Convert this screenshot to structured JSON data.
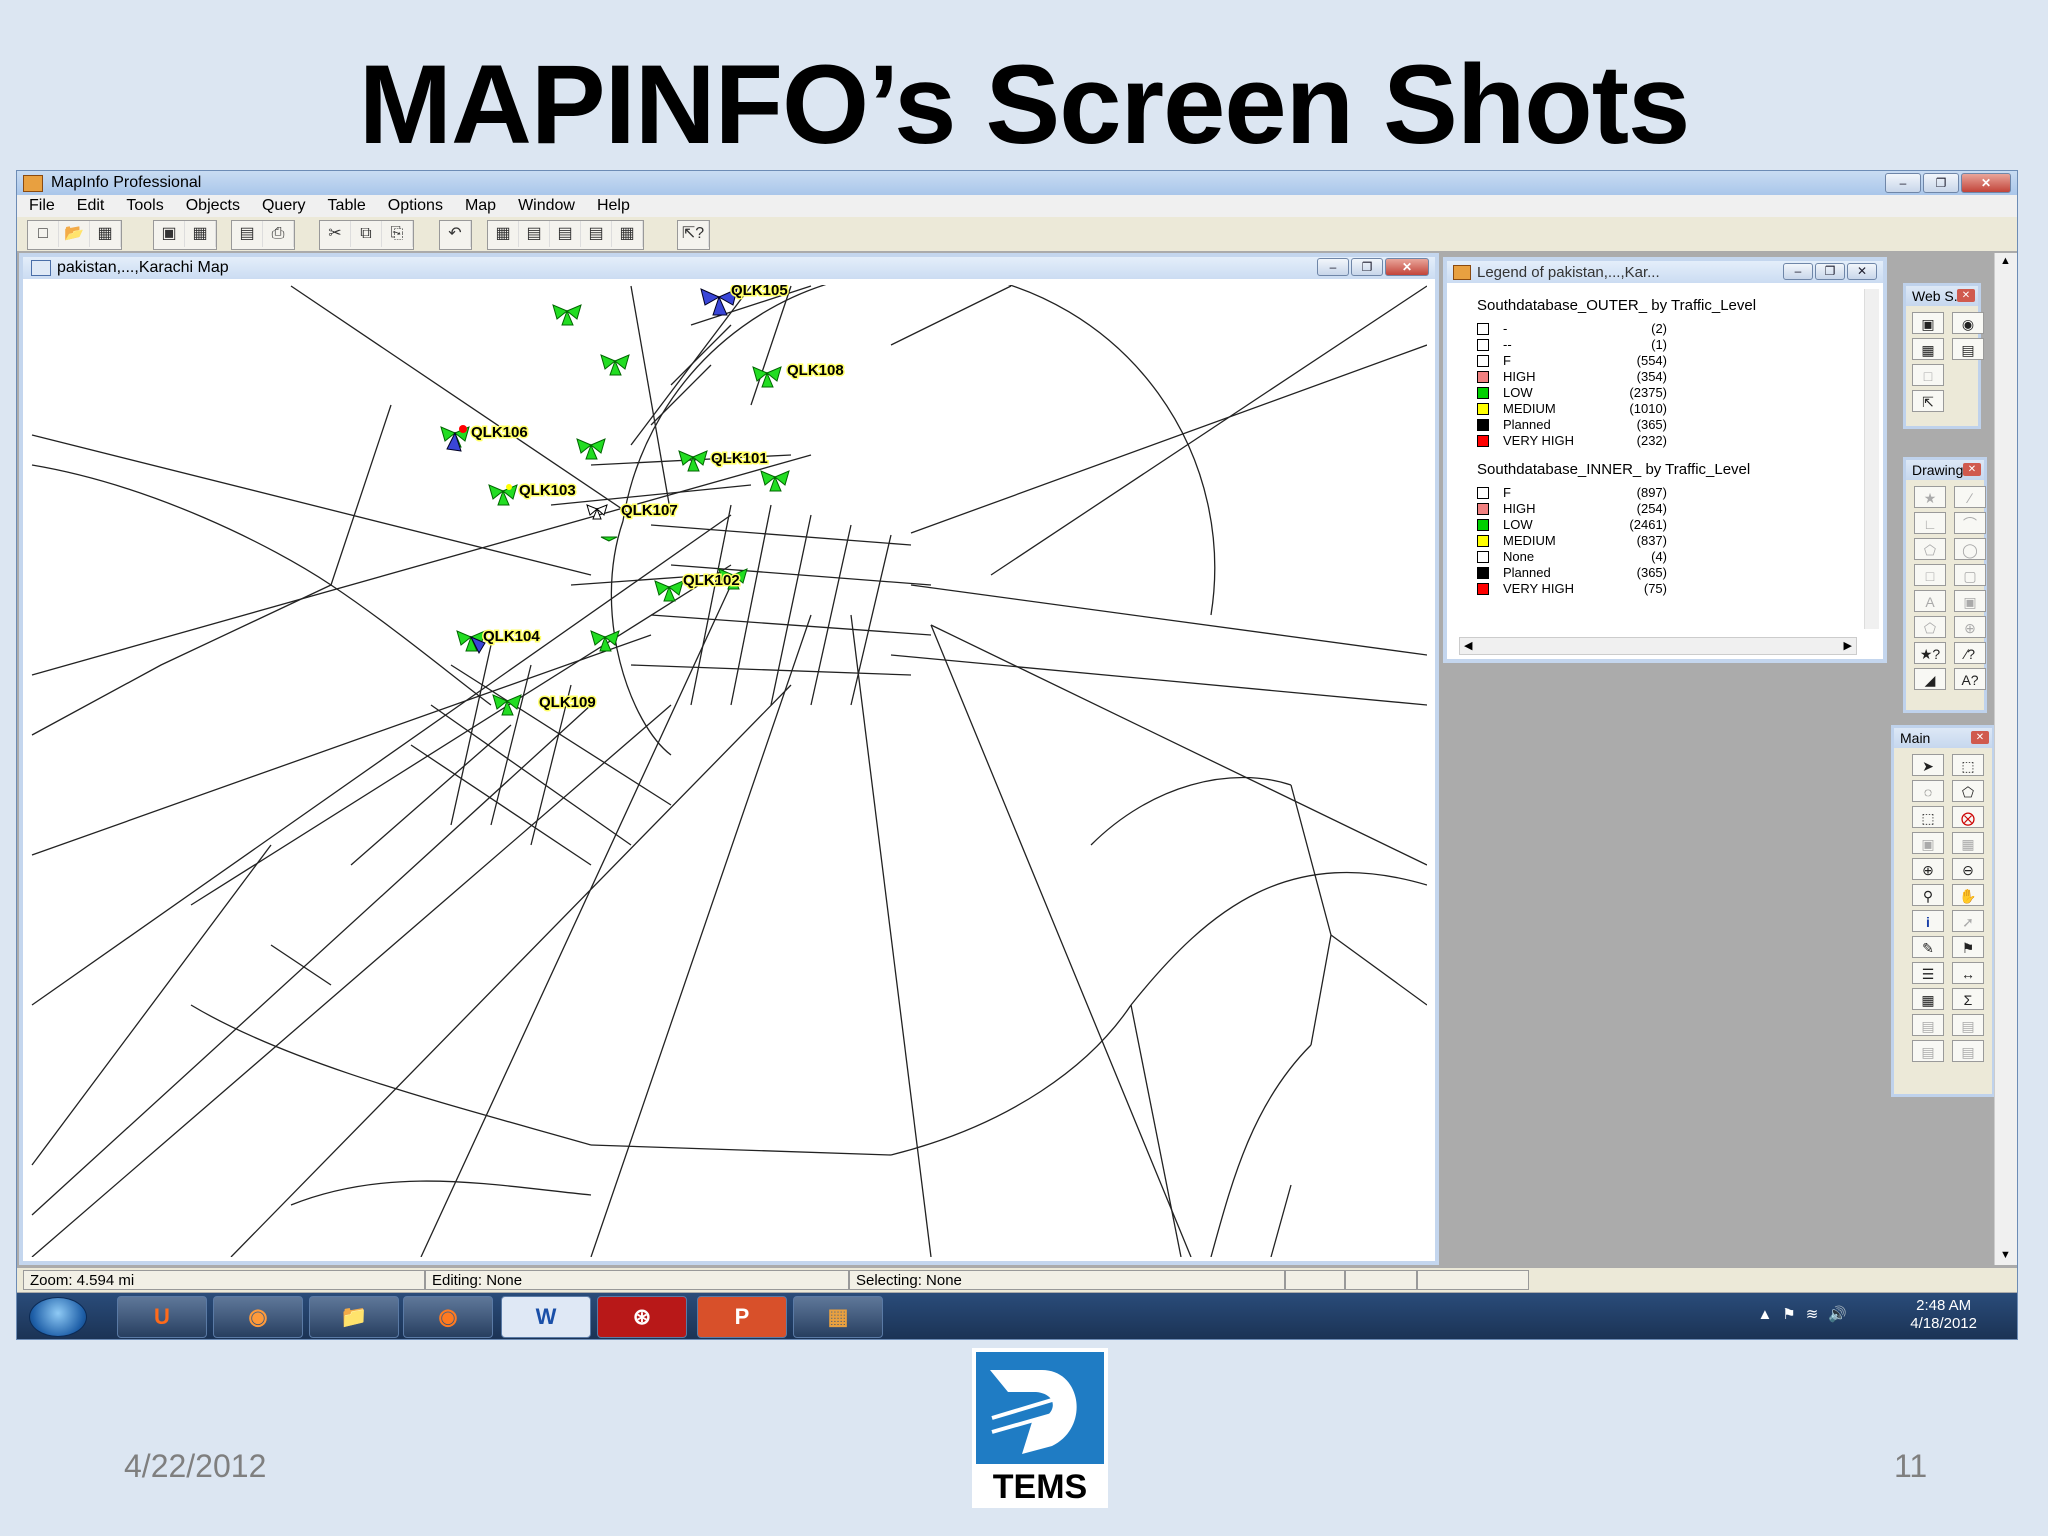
{
  "slide": {
    "title": "MAPINFO’s Screen Shots",
    "date": "4/22/2012",
    "page_number": "11",
    "logo_text": "TEMS"
  },
  "app": {
    "title": "MapInfo Professional",
    "menu": [
      "File",
      "Edit",
      "Tools",
      "Objects",
      "Query",
      "Table",
      "Options",
      "Map",
      "Window",
      "Help"
    ]
  },
  "map_window": {
    "title": "pakistan,...,Karachi Map",
    "site_labels": [
      "QLK105",
      "QLK108",
      "QLK106",
      "QLK101",
      "QLK103",
      "QLK107",
      "QLK102",
      "QLK104",
      "QLK109"
    ]
  },
  "legend_window": {
    "title": "Legend of pakistan,...,Kar...",
    "outer": {
      "heading": "Southdatabase_OUTER_ by Traffic_Level",
      "items": [
        {
          "label": "-",
          "count": "(2)",
          "color": "#ffffff"
        },
        {
          "label": "--",
          "count": "(1)",
          "color": "#ffffff"
        },
        {
          "label": "F",
          "count": "(554)",
          "color": "#ffffff"
        },
        {
          "label": "HIGH",
          "count": "(354)",
          "color": "#f08080"
        },
        {
          "label": "LOW",
          "count": "(2375)",
          "color": "#00d000"
        },
        {
          "label": "MEDIUM",
          "count": "(1010)",
          "color": "#ffff00"
        },
        {
          "label": "Planned",
          "count": "(365)",
          "color": "#000000"
        },
        {
          "label": "VERY HIGH",
          "count": "(232)",
          "color": "#ff0000"
        }
      ]
    },
    "inner": {
      "heading": "Southdatabase_INNER_ by Traffic_Level",
      "items": [
        {
          "label": "F",
          "count": "(897)",
          "color": "#ffffff"
        },
        {
          "label": "HIGH",
          "count": "(254)",
          "color": "#f08080"
        },
        {
          "label": "LOW",
          "count": "(2461)",
          "color": "#00d000"
        },
        {
          "label": "MEDIUM",
          "count": "(837)",
          "color": "#ffff00"
        },
        {
          "label": "None",
          "count": "(4)",
          "color": "#ffffff"
        },
        {
          "label": "Planned",
          "count": "(365)",
          "color": "#000000"
        },
        {
          "label": "VERY HIGH",
          "count": "(75)",
          "color": "#ff0000"
        }
      ]
    }
  },
  "palettes": {
    "web": "Web S...",
    "drawing": "Drawing",
    "main": "Main"
  },
  "status": {
    "zoom": "Zoom: 4.594 mi",
    "editing": "Editing: None",
    "selecting": "Selecting: None"
  },
  "taskbar": {
    "time": "2:48 AM",
    "date": "4/18/2012"
  }
}
